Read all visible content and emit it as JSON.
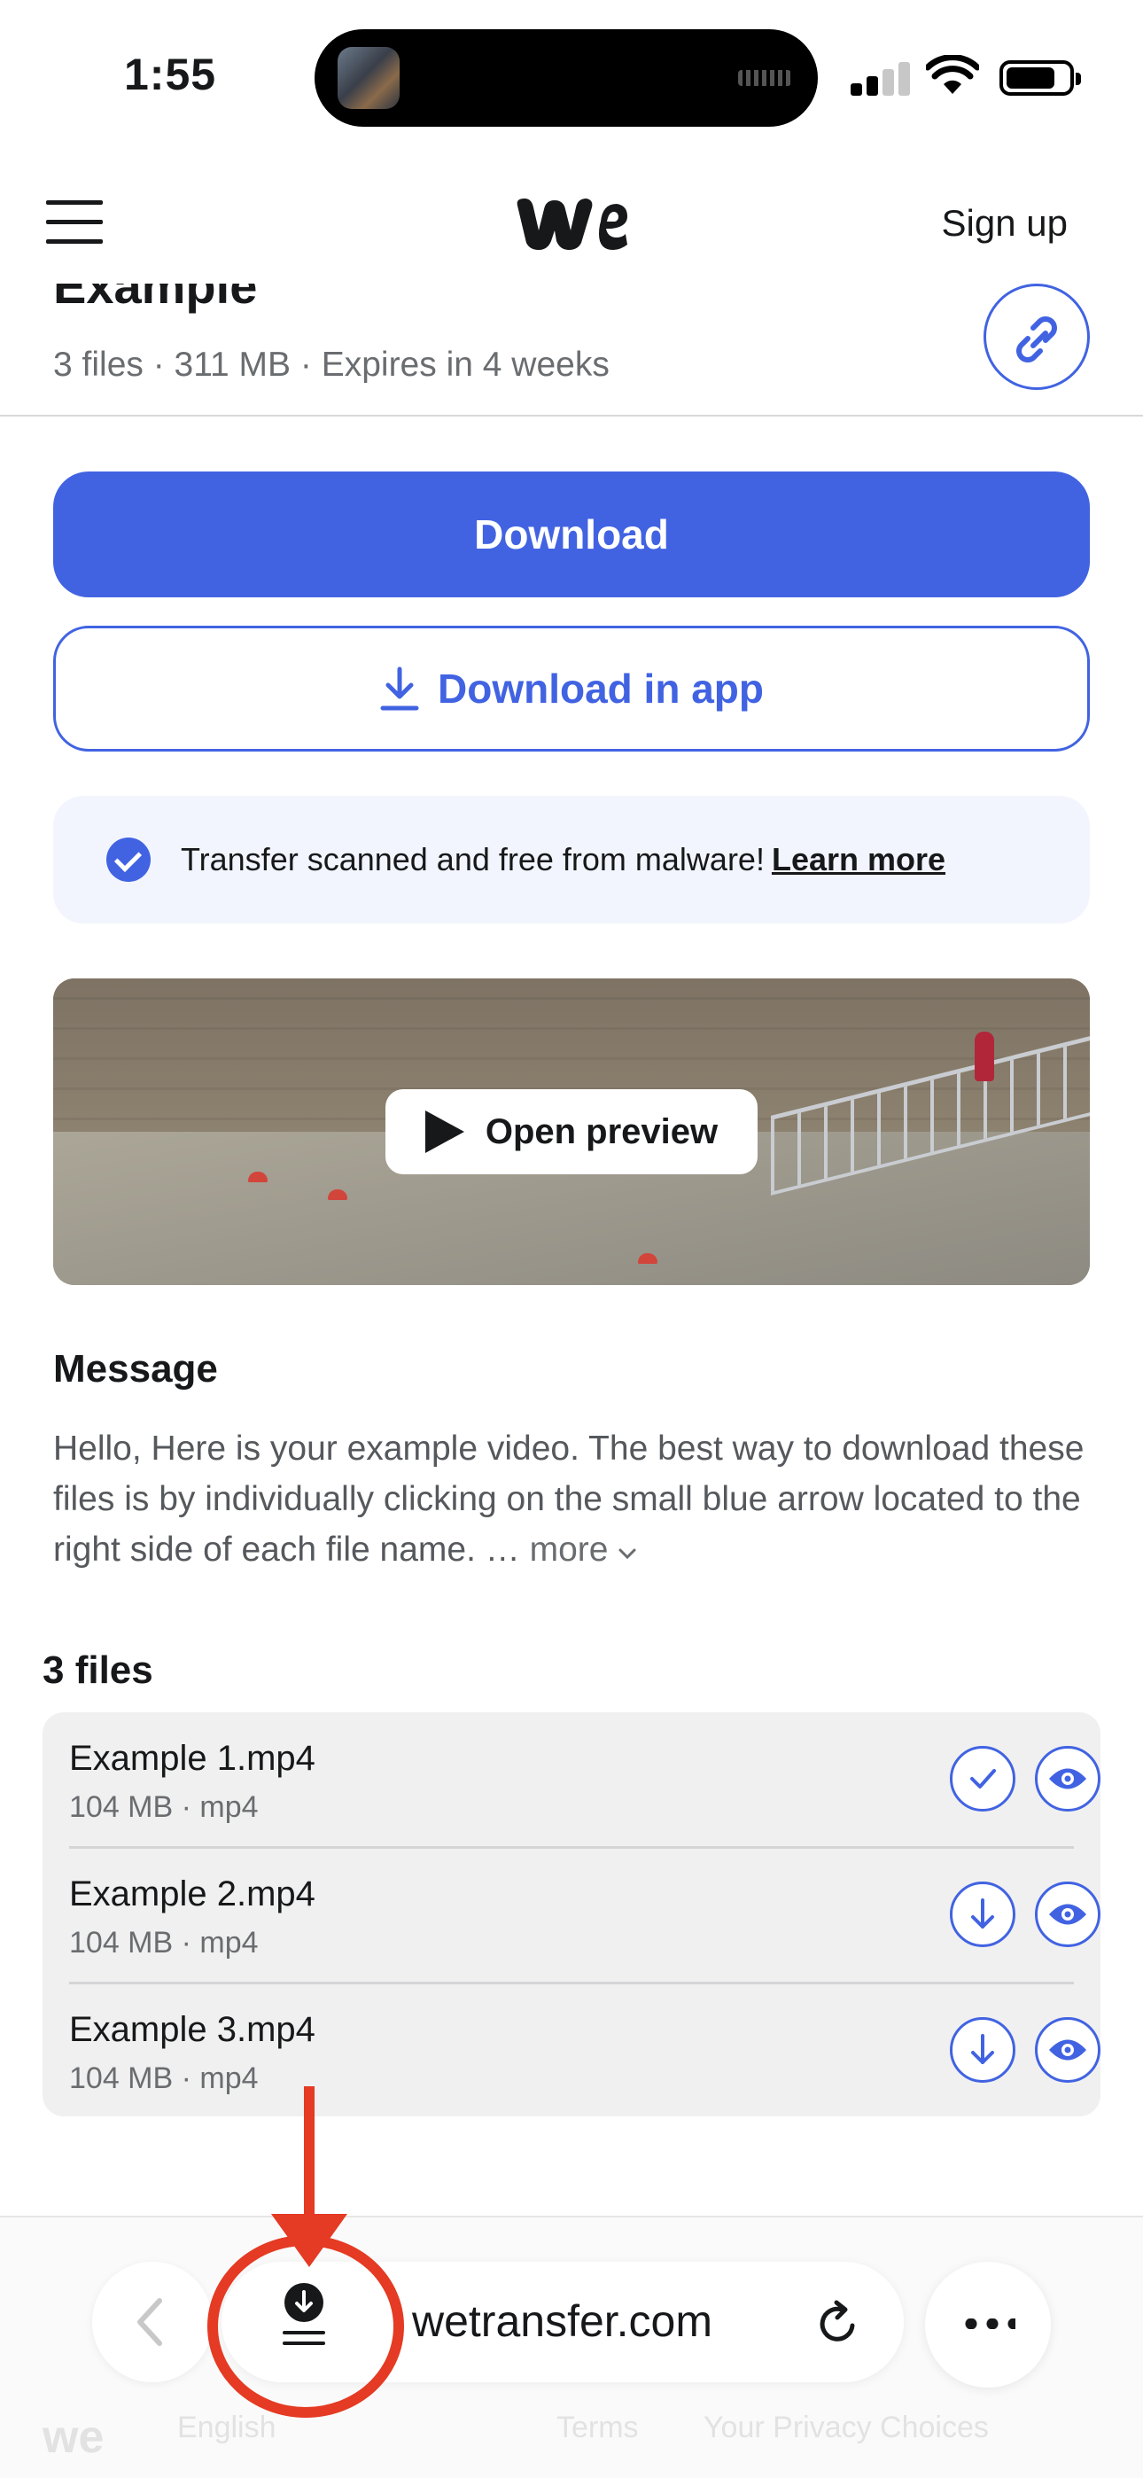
{
  "status_bar": {
    "time": "1:55"
  },
  "header": {
    "signup_label": "Sign up",
    "logo_icon": "wetransfer-logo-icon"
  },
  "transfer": {
    "title": "Example",
    "meta": "3 files · 311 MB · Expires in 4 weeks"
  },
  "actions": {
    "download_label": "Download",
    "download_app_label": "Download in app"
  },
  "scan": {
    "text": "Transfer scanned and free from malware!",
    "learn_more": "Learn more"
  },
  "preview": {
    "open_label": "Open preview"
  },
  "message": {
    "title": "Message",
    "body": "Hello, Here is your example video. The best way to download these files is by individually clicking on the small blue arrow located to the right side of each file name. …",
    "more_label": "more"
  },
  "files": {
    "title": "3 files",
    "items": [
      {
        "name": "Example 1.mp4",
        "meta": "104 MB · mp4",
        "status": "downloaded"
      },
      {
        "name": "Example 2.mp4",
        "meta": "104 MB · mp4",
        "status": "download"
      },
      {
        "name": "Example 3.mp4",
        "meta": "104 MB · mp4",
        "status": "download"
      }
    ]
  },
  "browser": {
    "url": "wetransfer.com"
  },
  "footer": {
    "language": "English",
    "terms": "Terms",
    "privacy": "Your Privacy Choices"
  },
  "colors": {
    "accent": "#4163e2",
    "annotation": "#e53a23"
  }
}
